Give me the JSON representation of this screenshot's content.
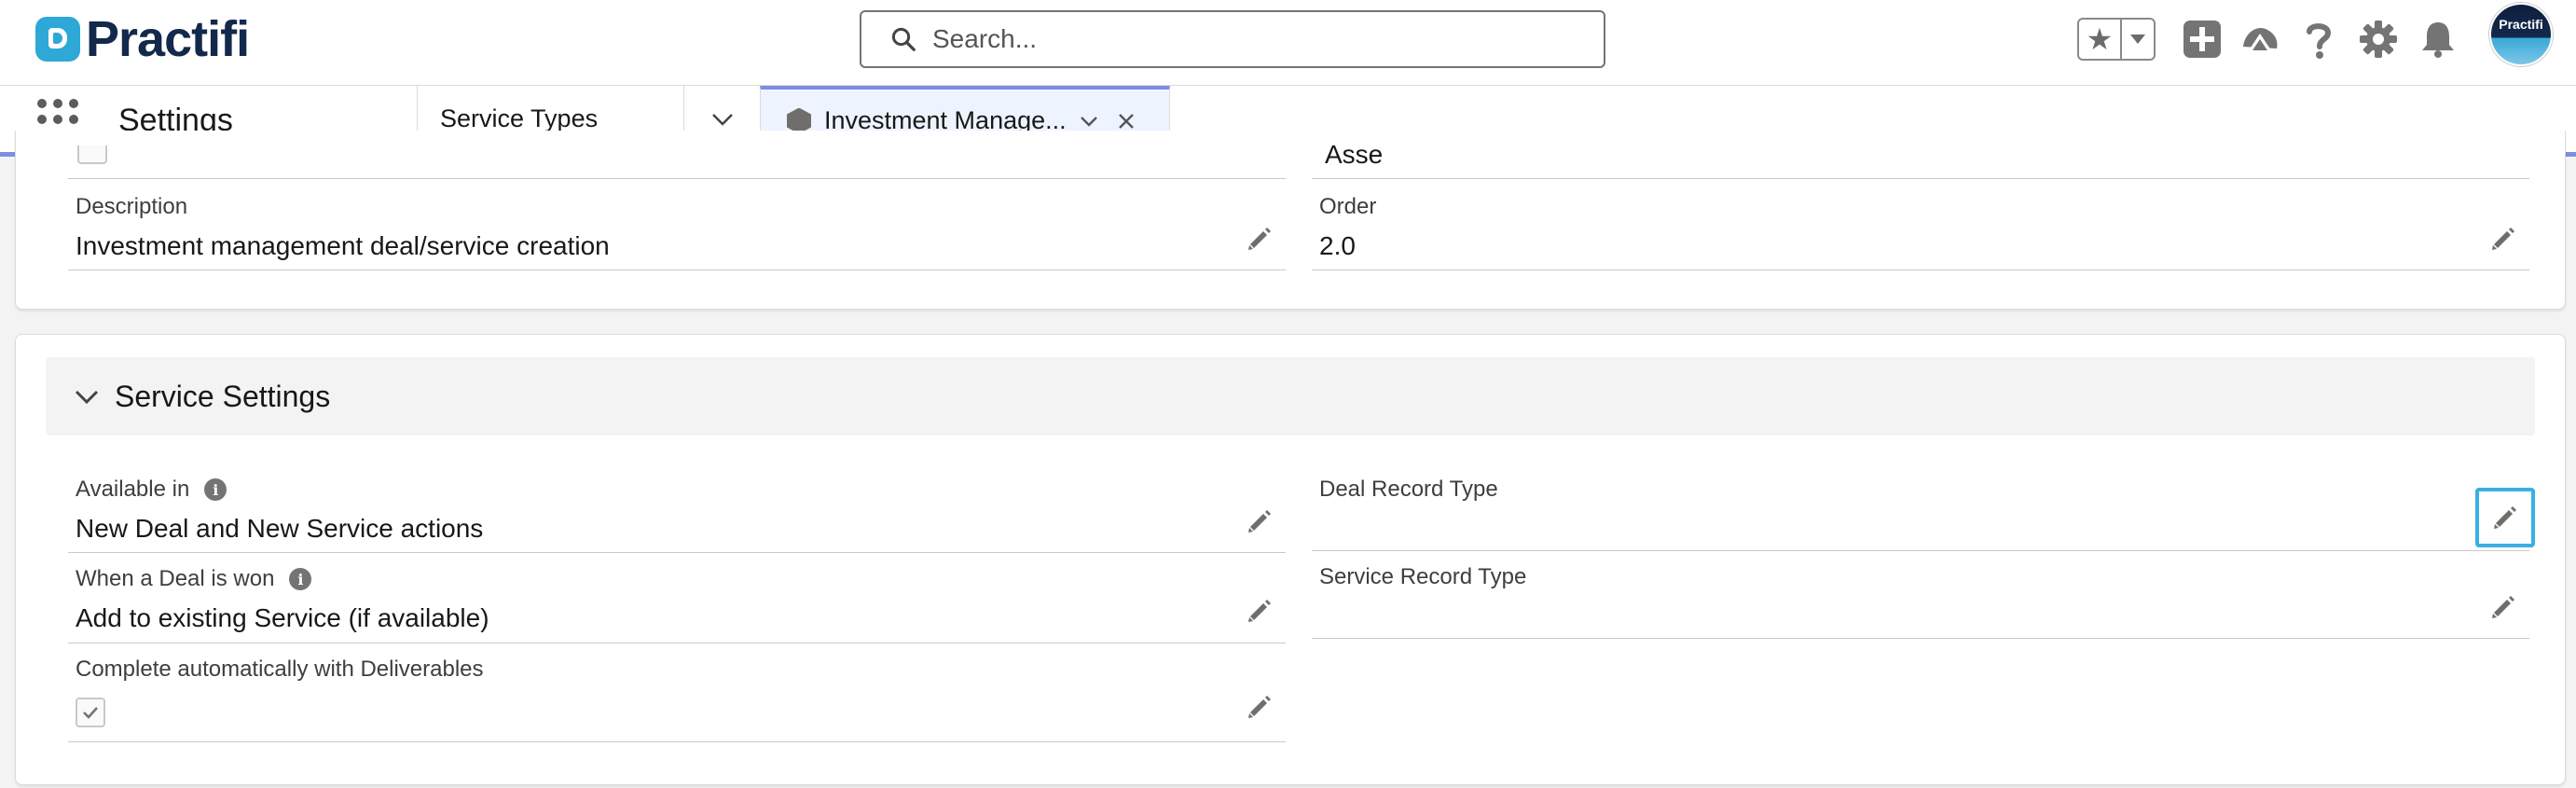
{
  "header": {
    "logo_text": "Practifi",
    "search_placeholder": "Search...",
    "avatar_text": "Practifi"
  },
  "nav": {
    "app_name": "Settings",
    "tabs": [
      {
        "label": "Service Types"
      },
      {
        "label": "Investment Manage..."
      }
    ]
  },
  "details": {
    "partial_value": "Asse",
    "description": {
      "label": "Description",
      "value": "Investment management deal/service creation"
    },
    "order": {
      "label": "Order",
      "value": "2.0"
    }
  },
  "service_settings": {
    "title": "Service Settings",
    "available_in": {
      "label": "Available in",
      "value": "New Deal and New Service actions"
    },
    "deal_won": {
      "label": "When a Deal is won",
      "value": "Add to existing Service (if available)"
    },
    "complete_auto": {
      "label": "Complete automatically with Deliverables",
      "checked": true
    },
    "deal_record_type": {
      "label": "Deal Record Type",
      "value": ""
    },
    "service_record_type": {
      "label": "Service Record Type",
      "value": ""
    }
  },
  "colors": {
    "brand_navy": "#13294b",
    "brand_teal": "#2ea8d6",
    "tab_accent": "#7c8ee0",
    "focus_ring": "#3ab0e2"
  },
  "icons": [
    "search-icon",
    "star-icon",
    "chevron-down-icon",
    "add-icon",
    "trailhead-icon",
    "help-icon",
    "gear-icon",
    "bell-icon",
    "app-launcher-icon",
    "hexagon-icon",
    "close-icon",
    "pencil-icon",
    "info-icon",
    "check-icon"
  ]
}
